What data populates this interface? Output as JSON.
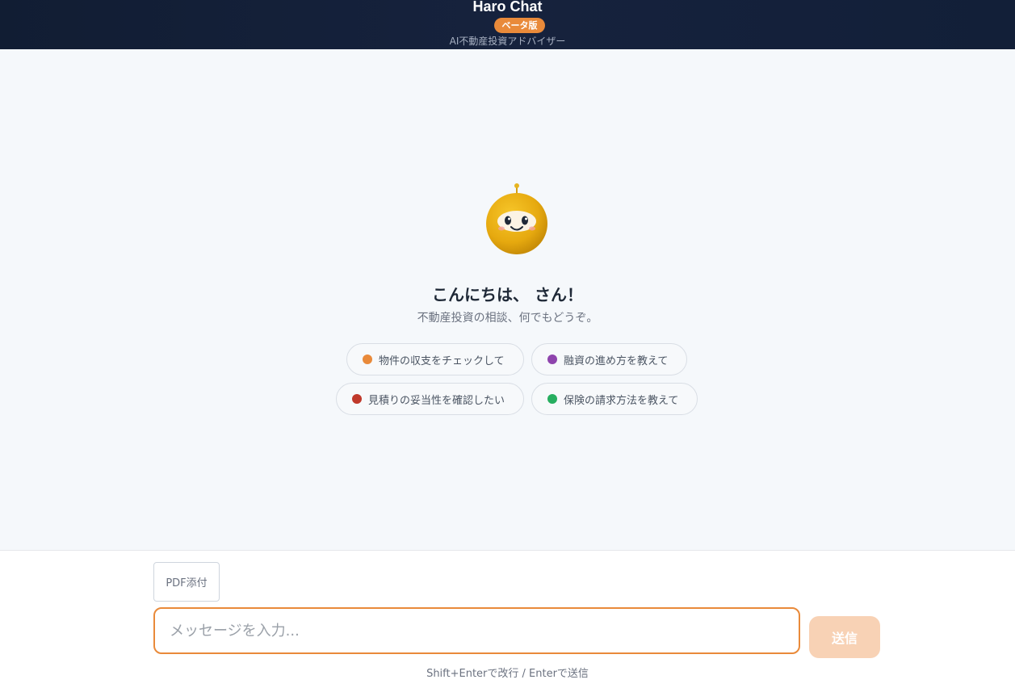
{
  "header": {
    "title": "Haro Chat",
    "badge": "ベータ版",
    "subtitle": "AI不動産投資アドバイザー",
    "accent": "#e98a3a"
  },
  "welcome": {
    "mascot_icon": "robot-mascot-icon",
    "greeting": "こんにちは、 さん！",
    "subtitle": "不動産投資の相談、何でもどうぞ。"
  },
  "suggestions": [
    {
      "label": "物件の収支をチェックして",
      "color": "#e98a3a"
    },
    {
      "label": "融資の進め方を教えて",
      "color": "#8e44ad"
    },
    {
      "label": "見積りの妥当性を確認したい",
      "color": "#c0392b"
    },
    {
      "label": "保険の請求方法を教えて",
      "color": "#27ae60"
    }
  ],
  "composer": {
    "pdf_label": "PDF添付",
    "placeholder": "メッセージを入力...",
    "value": "",
    "send_label": "送信",
    "hint": "Shift+Enterで改行 / Enterで送信"
  }
}
